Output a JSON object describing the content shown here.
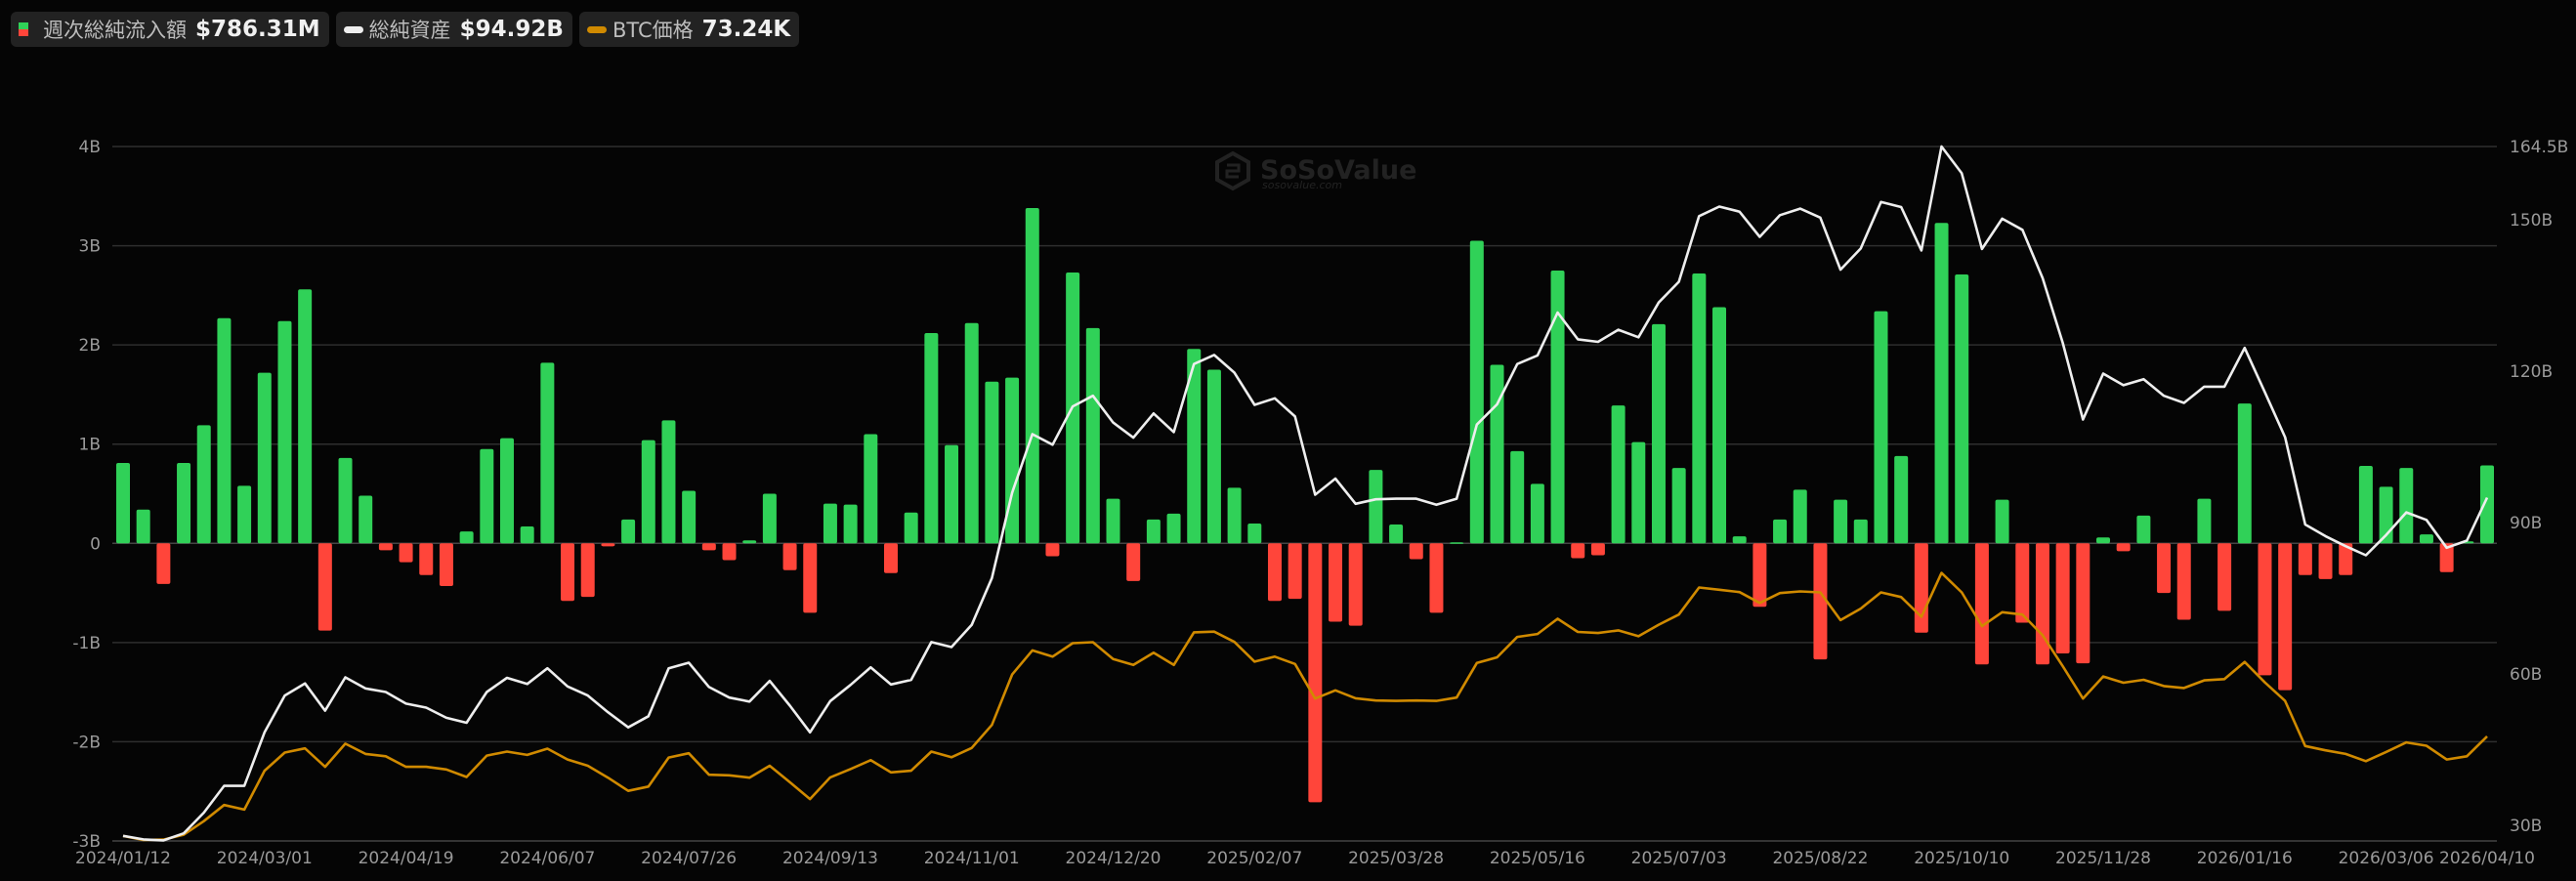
{
  "legend": {
    "flow": {
      "label": "週次総純流入額",
      "value": "$786.31M",
      "pos_color": "#30d158",
      "neg_color": "#ff453a"
    },
    "assets": {
      "label": "総純資産",
      "value": "$94.92B",
      "color": "#eeeeee"
    },
    "btc": {
      "label": "BTC価格",
      "value": "73.24K",
      "color": "#d08a00"
    }
  },
  "watermark": {
    "brand": "SoSoValue",
    "site": "sosovalue.com"
  },
  "chart_data": {
    "type": "bar+line",
    "x_tick_labels": [
      "2024/01/12",
      "2024/03/01",
      "2024/04/19",
      "2024/06/07",
      "2024/07/26",
      "2024/09/13",
      "2024/11/01",
      "2024/12/20",
      "2025/02/07",
      "2025/03/28",
      "2025/05/16",
      "2025/07/03",
      "2025/08/22",
      "2025/10/10",
      "2025/11/28",
      "2026/01/16",
      "2026/03/06",
      "2026/04/10"
    ],
    "x_tick_every_weeks": 7,
    "left_axis": {
      "ticks": [
        "4B",
        "3B",
        "2B",
        "1B",
        "0",
        "-1B",
        "-2B",
        "-3B"
      ],
      "ylim": [
        -3,
        4
      ],
      "unit": "B USD"
    },
    "right_axis": {
      "ticks": [
        "164.5B",
        "150B",
        "120B",
        "90B",
        "60B",
        "30B"
      ],
      "tick_values": [
        164.5,
        150,
        120,
        90,
        60,
        30
      ],
      "ylim": [
        26.5,
        164.5
      ],
      "unit": "B USD"
    },
    "btc_axis_range_k": [
      40.9,
      252.2
    ],
    "grid": true,
    "series": [
      {
        "name": "週次総純流入額",
        "type": "bar",
        "unit": "B USD",
        "values": [
          0.81,
          0.34,
          -0.41,
          0.81,
          1.19,
          2.27,
          0.58,
          1.72,
          2.24,
          2.56,
          -0.88,
          0.86,
          0.48,
          -0.07,
          -0.19,
          -0.32,
          -0.43,
          0.12,
          0.95,
          1.06,
          0.17,
          1.82,
          -0.58,
          -0.54,
          -0.03,
          0.24,
          1.04,
          1.24,
          0.53,
          -0.07,
          -0.17,
          0.03,
          0.5,
          -0.27,
          -0.7,
          0.4,
          0.39,
          1.1,
          -0.3,
          0.31,
          2.12,
          0.99,
          2.22,
          1.63,
          1.67,
          3.38,
          -0.13,
          2.73,
          2.17,
          0.45,
          -0.38,
          0.24,
          0.3,
          1.96,
          1.75,
          0.56,
          0.2,
          -0.58,
          -0.56,
          -2.61,
          -0.79,
          -0.83,
          0.74,
          0.19,
          -0.16,
          -0.7,
          0.01,
          3.05,
          1.8,
          0.93,
          0.6,
          2.75,
          -0.15,
          -0.12,
          1.39,
          1.02,
          2.21,
          0.76,
          2.72,
          2.38,
          0.07,
          -0.64,
          0.24,
          0.54,
          -1.17,
          0.44,
          0.24,
          2.34,
          0.88,
          -0.9,
          3.23,
          2.71,
          -1.22,
          0.44,
          -0.8,
          -1.22,
          -1.11,
          -1.21,
          0.06,
          -0.08,
          0.28,
          -0.5,
          -0.77,
          0.45,
          -0.68,
          1.41,
          -1.33,
          -1.48,
          -0.32,
          -0.36,
          -0.32,
          0.78,
          0.57,
          0.76,
          0.09,
          -0.29,
          0.02,
          0.786
        ]
      },
      {
        "name": "総純資産",
        "type": "line",
        "unit": "B USD",
        "values": [
          27.9,
          27.2,
          27.0,
          28.4,
          32.5,
          37.8,
          37.8,
          48.4,
          55.7,
          58.1,
          52.7,
          59.3,
          57.1,
          56.4,
          54.1,
          53.3,
          51.3,
          50.3,
          56.4,
          59.2,
          58.0,
          61.1,
          57.5,
          55.7,
          52.4,
          49.4,
          51.6,
          61.1,
          62.2,
          57.4,
          55.3,
          54.5,
          58.6,
          53.7,
          48.4,
          54.6,
          57.8,
          61.3,
          57.9,
          58.8,
          66.3,
          65.3,
          69.7,
          79.0,
          95.9,
          107.5,
          105.4,
          113.0,
          115.1,
          109.8,
          106.8,
          111.6,
          107.9,
          121.4,
          123.2,
          119.7,
          113.3,
          114.6,
          111.0,
          95.5,
          98.7,
          93.7,
          94.6,
          94.7,
          94.7,
          93.5,
          94.7,
          109.4,
          113.4,
          121.4,
          123.1,
          131.6,
          126.3,
          125.8,
          128.2,
          126.7,
          133.6,
          137.7,
          150.7,
          152.6,
          151.6,
          146.6,
          150.9,
          152.2,
          150.4,
          140.1,
          144.3,
          153.5,
          152.5,
          143.9,
          164.5,
          159.2,
          144.2,
          150.2,
          148.0,
          138.4,
          125.6,
          110.4,
          119.5,
          117.2,
          118.4,
          115.1,
          113.7,
          116.9,
          116.9,
          124.6,
          115.8,
          106.9,
          89.6,
          87.3,
          85.3,
          83.5,
          87.5,
          92.0,
          90.5,
          85.0,
          86.4,
          94.92
        ]
      },
      {
        "name": "BTC価格",
        "type": "line",
        "unit": "K USD",
        "values": [
          43.0,
          41.8,
          41.9,
          43.4,
          47.5,
          52.4,
          51.0,
          62.8,
          68.3,
          69.6,
          64.0,
          71.0,
          67.9,
          67.2,
          64.0,
          64.0,
          63.2,
          60.9,
          67.4,
          68.6,
          67.6,
          69.5,
          66.2,
          64.3,
          60.7,
          56.7,
          58.0,
          66.8,
          68.1,
          61.6,
          61.4,
          60.7,
          64.3,
          59.3,
          54.2,
          60.8,
          63.3,
          66.0,
          62.3,
          62.8,
          68.6,
          66.9,
          69.7,
          76.7,
          92.0,
          99.3,
          97.4,
          101.5,
          101.8,
          96.7,
          94.9,
          98.6,
          94.9,
          104.8,
          105.0,
          101.9,
          95.9,
          97.4,
          95.2,
          84.7,
          87.2,
          84.8,
          84.1,
          84.0,
          84.1,
          84.0,
          85.0,
          95.5,
          97.2,
          103.4,
          104.3,
          108.9,
          104.9,
          104.6,
          105.4,
          103.6,
          107.1,
          110.2,
          118.4,
          117.7,
          117.0,
          113.7,
          116.7,
          117.2,
          116.9,
          108.5,
          112.0,
          116.9,
          115.5,
          109.5,
          122.8,
          116.9,
          106.7,
          110.9,
          110.2,
          103.9,
          94.5,
          84.7,
          91.4,
          89.5,
          90.4,
          88.5,
          87.9,
          90.2,
          90.6,
          95.8,
          89.6,
          84.0,
          70.3,
          69.0,
          67.9,
          65.7,
          68.5,
          71.4,
          70.4,
          66.2,
          67.2,
          73.24
        ]
      }
    ]
  }
}
